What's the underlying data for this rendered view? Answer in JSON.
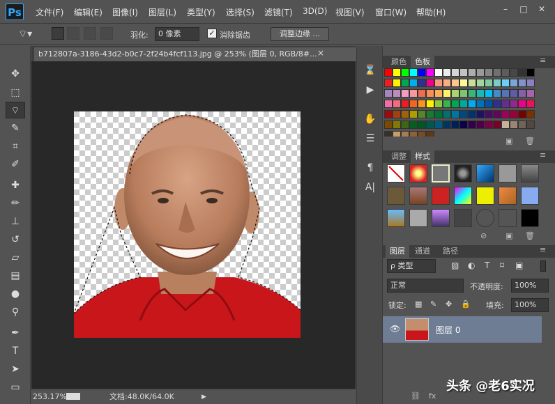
{
  "app": {
    "logo": "Ps"
  },
  "menu": [
    "文件(F)",
    "编辑(E)",
    "图像(I)",
    "图层(L)",
    "类型(Y)",
    "选择(S)",
    "滤镜(T)",
    "3D(D)",
    "视图(V)",
    "窗口(W)",
    "帮助(H)"
  ],
  "window_controls": {
    "minimize": "–",
    "restore": "□",
    "close": "✕"
  },
  "options": {
    "feather_label": "羽化:",
    "feather_value": "0 像素",
    "antialias_checked": true,
    "antialias_label": "消除锯齿",
    "refine_edge_label": "调整边缘 ..."
  },
  "document": {
    "tab_title": "b712807a-3186-43d2-b0c7-2f24b4fcf113.jpg @ 253% (图层 0, RGB/8#...",
    "tab_close": "×",
    "zoom": "253.17%",
    "doc_info": "文档:48.0K/64.0K"
  },
  "swatches_panel": {
    "tabs": [
      "颜色",
      "色板"
    ],
    "active_tab": 1,
    "colors": [
      "#ff0000",
      "#ffff00",
      "#00ff00",
      "#00ffff",
      "#0000ff",
      "#ff00ff",
      "#ffffff",
      "#ebebeb",
      "#d6d6d6",
      "#c2c2c2",
      "#adadad",
      "#999999",
      "#858585",
      "#707070",
      "#5c5c5c",
      "#474747",
      "#333333",
      "#000000",
      "#ee1d24",
      "#fff100",
      "#00a650",
      "#00aeef",
      "#2f3192",
      "#ed008c",
      "#f7977a",
      "#fbad82",
      "#fdc68c",
      "#fff799",
      "#c6df9c",
      "#a4d49d",
      "#81ca9d",
      "#7bcdc9",
      "#6ccff7",
      "#7ca6d8",
      "#8293ca",
      "#8881be",
      "#a286bd",
      "#bc8cbf",
      "#f49bc1",
      "#f5999d",
      "#f16c4d",
      "#f68e56",
      "#fbaf5a",
      "#fff467",
      "#acd372",
      "#7dc473",
      "#39b778",
      "#16bcb4",
      "#00bff3",
      "#438ccb",
      "#5573b7",
      "#5e5ca7",
      "#855fa8",
      "#a763a9",
      "#ef6ea8",
      "#f16d7e",
      "#ee1d24",
      "#f16522",
      "#f7941d",
      "#fff100",
      "#8fc63d",
      "#37b44a",
      "#00a650",
      "#00a99e",
      "#00aeef",
      "#0072bc",
      "#0054a5",
      "#2f3192",
      "#652c91",
      "#91278f",
      "#ed008c",
      "#ee105a",
      "#9d0a0f",
      "#a1410d",
      "#a36209",
      "#aba000",
      "#588528",
      "#197b30",
      "#007236",
      "#00736a",
      "#0076a4",
      "#004a80",
      "#003370",
      "#1d1363",
      "#450e61",
      "#62055f",
      "#9e005c",
      "#9d0039",
      "#790000",
      "#7b3000",
      "#7c4900",
      "#827a00",
      "#3e6617",
      "#045f20",
      "#005824",
      "#005951",
      "#005b7e",
      "#003562",
      "#002056",
      "#0c004b",
      "#30004a",
      "#4b0048",
      "#7a0045",
      "#7a0026",
      "#c7b299",
      "#998675",
      "#736357",
      "#534741",
      "#37302a",
      "#c69c6d",
      "#a67c52",
      "#8c6239",
      "#754c24",
      "#603913"
    ]
  },
  "styles_panel": {
    "tabs": [
      "调整",
      "样式"
    ],
    "active_tab": 1
  },
  "layers_panel": {
    "tabs": [
      "图层",
      "通道",
      "路径"
    ],
    "active_tab": 0,
    "filter_label": "ρ 类型",
    "blend_mode": "正常",
    "opacity_label": "不透明度:",
    "opacity_value": "100%",
    "lock_label": "锁定:",
    "fill_label": "填充:",
    "fill_value": "100%",
    "layers": [
      {
        "name": "图层 0",
        "visible": true
      }
    ]
  },
  "watermark": "头条 @老6实况"
}
